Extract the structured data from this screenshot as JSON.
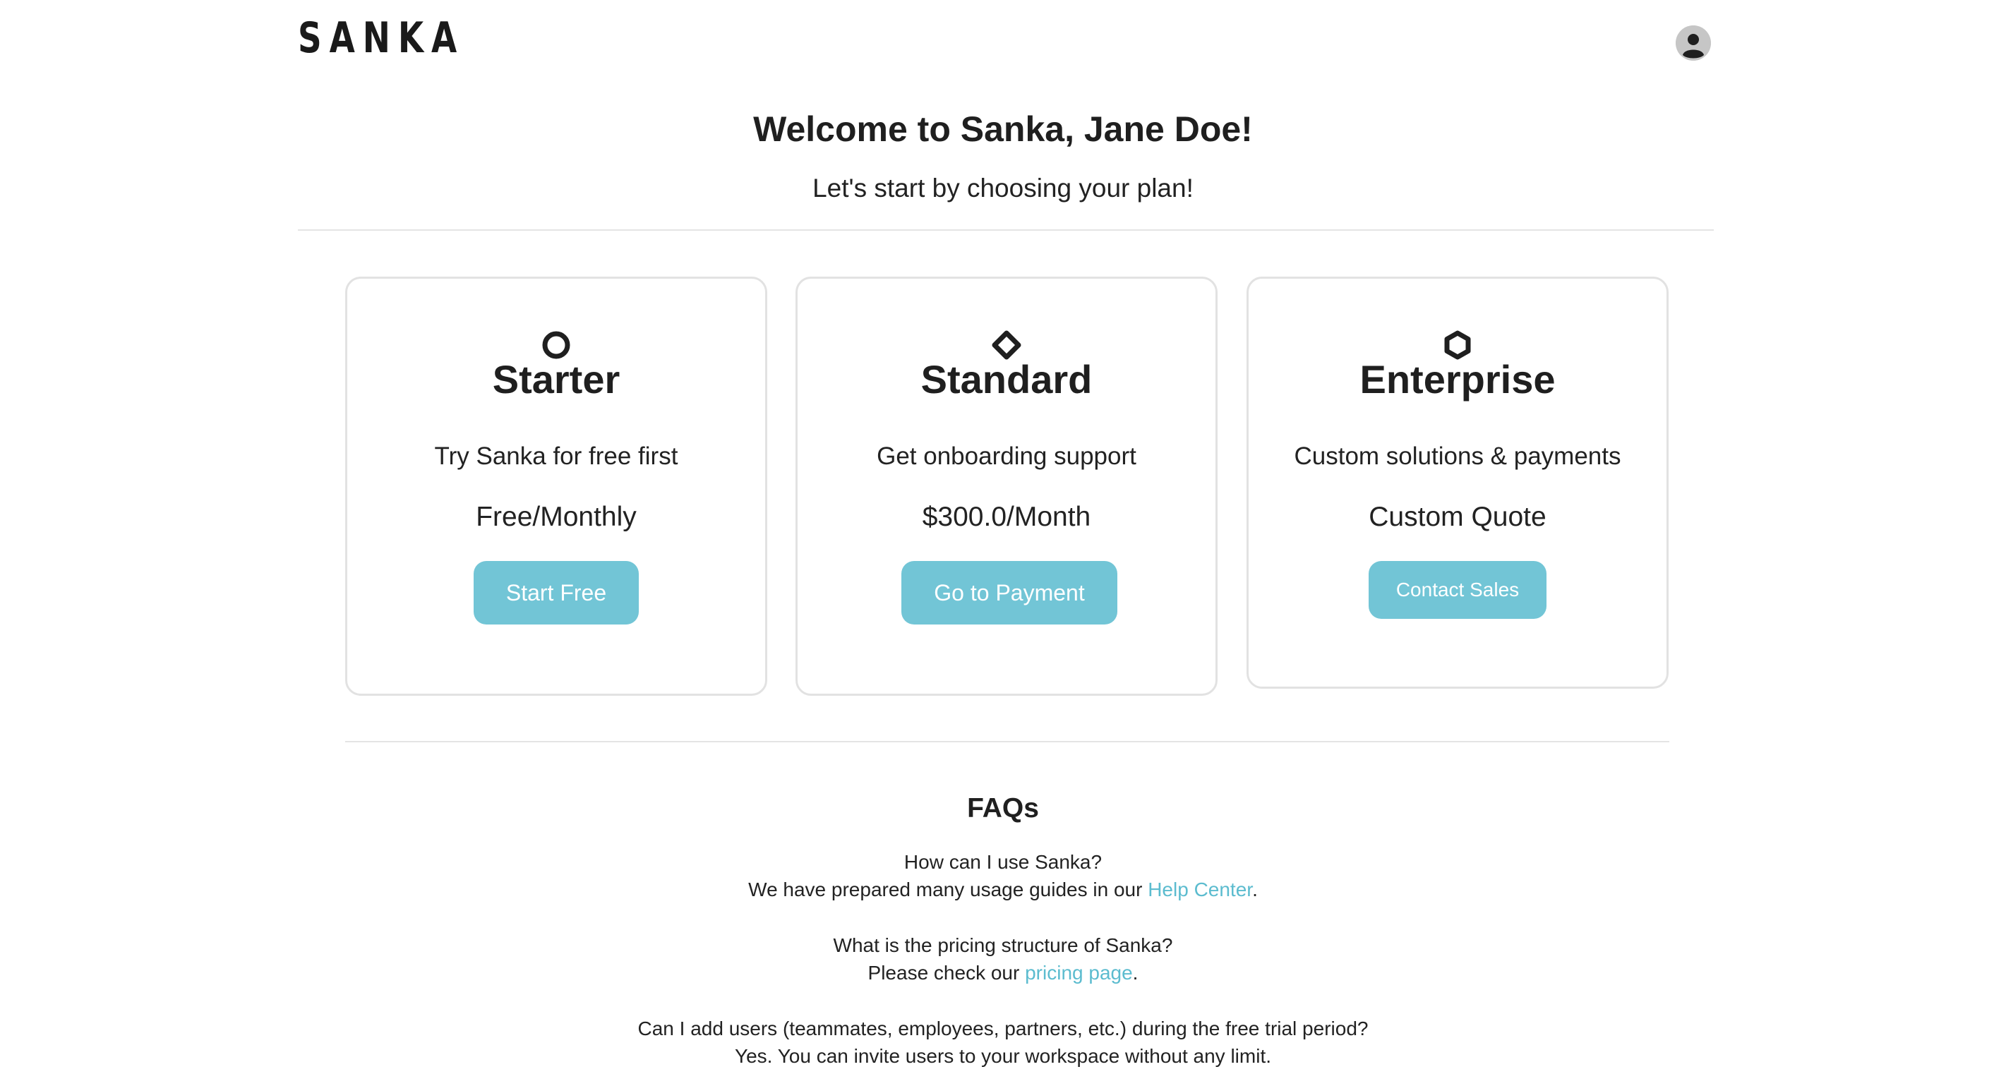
{
  "header": {
    "logo_text": "SANKA",
    "avatar_icon": "user-avatar-icon"
  },
  "welcome": {
    "title": "Welcome to Sanka, Jane Doe!",
    "subtitle": "Let's start by choosing your plan!"
  },
  "plans": [
    {
      "icon": "circle-icon",
      "name": "Starter",
      "description": "Try Sanka for free first",
      "price": "Free/Monthly",
      "button_label": "Start Free"
    },
    {
      "icon": "diamond-icon",
      "name": "Standard",
      "description": "Get onboarding support",
      "price": "$300.0/Month",
      "button_label": "Go to Payment"
    },
    {
      "icon": "hexagon-icon",
      "name": "Enterprise",
      "description": "Custom solutions & payments",
      "price": "Custom Quote",
      "button_label": "Contact Sales"
    }
  ],
  "faq": {
    "title": "FAQs",
    "items": [
      {
        "question": "How can I use Sanka?",
        "answer_prefix": "We have prepared many usage guides in our ",
        "answer_link": "Help Center",
        "answer_suffix": "."
      },
      {
        "question": "What is the pricing structure of Sanka?",
        "answer_prefix": "Please check our ",
        "answer_link": "pricing page",
        "answer_suffix": "."
      },
      {
        "question": "Can I add users (teammates, employees, partners, etc.) during the free trial period?",
        "answer": "Yes. You can invite users to your workspace without any limit."
      }
    ]
  },
  "colors": {
    "accent": "#72c5d6",
    "link": "#5cbccf",
    "border": "#e2e2e2",
    "text": "#222222"
  }
}
